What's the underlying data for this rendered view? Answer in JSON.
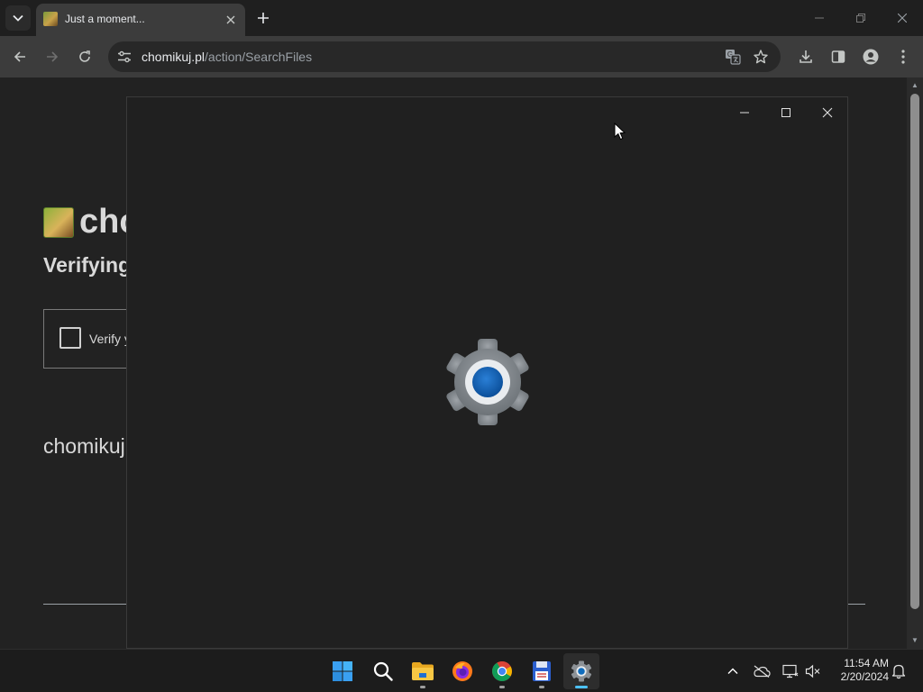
{
  "browser": {
    "tab": {
      "title": "Just a moment..."
    },
    "address": {
      "host": "chomikuj.pl",
      "path": "/action/SearchFiles"
    }
  },
  "page": {
    "site_name": "chomikuj.pl",
    "heading": "Verifying",
    "checkbox_label": "Verify y",
    "domain": "chomikuj"
  },
  "splash": {
    "app": "Settings",
    "icon": "settings-gear-icon"
  },
  "taskbar": {
    "apps": [
      {
        "name": "Start",
        "icon": "windows-logo-icon"
      },
      {
        "name": "Search",
        "icon": "search-icon"
      },
      {
        "name": "File Explorer",
        "icon": "folder-icon"
      },
      {
        "name": "Firefox",
        "icon": "firefox-icon"
      },
      {
        "name": "Chrome",
        "icon": "chrome-icon"
      },
      {
        "name": "Save",
        "icon": "floppy-disk-icon"
      },
      {
        "name": "Settings",
        "icon": "settings-gear-icon",
        "active": true
      }
    ],
    "clock": {
      "time": "11:54 AM",
      "date": "2/20/2024"
    }
  },
  "colors": {
    "accent": "#4cc2ff",
    "gear_center": "#0f6cbd",
    "page_bg": "#222222"
  }
}
